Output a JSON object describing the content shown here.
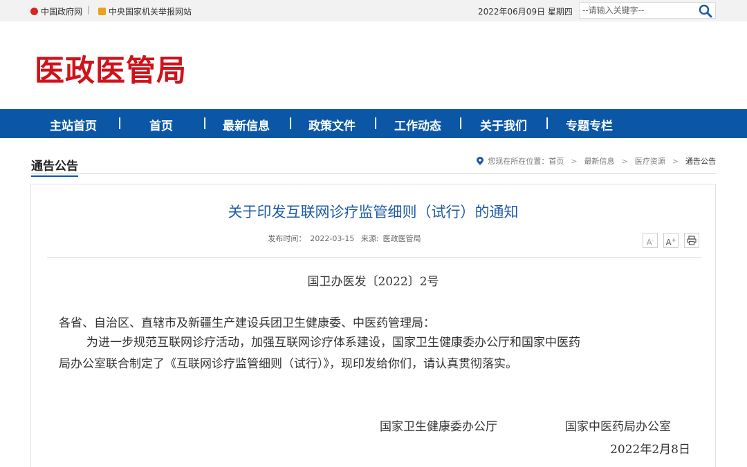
{
  "topbar": {
    "link1": "中国政府网",
    "separator": "|",
    "link2": "中央国家机关举报网站",
    "date": "2022年06月09日 星期四",
    "search_placeholder": "--请输入关键字--"
  },
  "header": {
    "logo_text": "医政医管局"
  },
  "nav": {
    "items": [
      "主站首页",
      "首页",
      "最新信息",
      "政策文件",
      "工作动态",
      "关于我们",
      "专题专栏"
    ],
    "separator": "|"
  },
  "section": {
    "title": "通告公告",
    "breadcrumb": {
      "prefix": "您现在所在位置：",
      "items": [
        "首页",
        "最新信息",
        "医疗资源",
        "通告公告"
      ],
      "separator": ">"
    }
  },
  "article": {
    "title": "关于印发互联网诊疗监管细则（试行）的通知",
    "meta": {
      "date_label": "发布时间：",
      "date": "2022-03-15",
      "source_label": "来源:",
      "source": "医政医管局"
    },
    "tools": {
      "font_smaller": "A",
      "font_larger": "A",
      "print_icon": "print-icon"
    },
    "doc_number": "国卫办医发〔2022〕2号",
    "addressee": "各省、自治区、直辖市及新疆生产建设兵团卫生健康委、中医药管理局：",
    "paragraph_line1": "为进一步规范互联网诊疗活动，加强互联网诊疗体系建设，国家卫生健康委办公厅和国家中医药",
    "paragraph_line2": "局办公室联合制定了《互联网诊疗监管细则（试行）》，现印发给你们，请认真贯彻落实。",
    "signatory1": "国家卫生健康委办公厅",
    "signatory2": "国家中医药局办公室",
    "sign_date": "2022年2月8日"
  },
  "colors": {
    "nav_bg": "#0b57a6",
    "logo": "#d0121b",
    "title": "#1d5aa5"
  }
}
